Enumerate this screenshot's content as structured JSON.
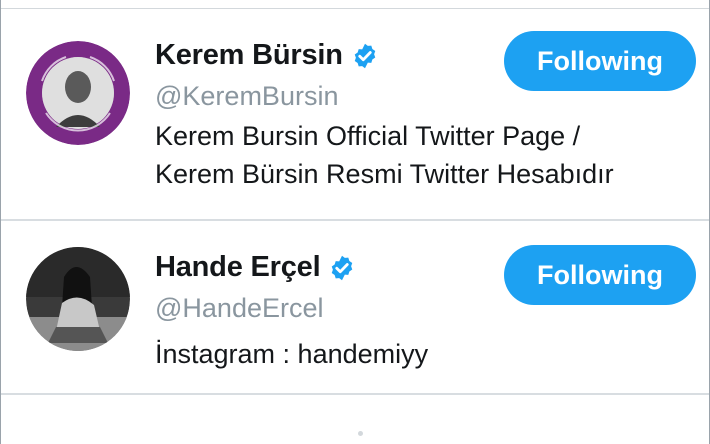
{
  "accent_color": "#1da1f2",
  "users": [
    {
      "name": "Kerem Bürsin",
      "handle": "@KeremBursin",
      "bio_lines": [
        "Kerem Bursin Official Twitter Page /",
        "Kerem Bürsin Resmi Twitter Hesabıdır"
      ],
      "verified": true,
      "follow_label": "Following",
      "avatar_icon": "profile-photo-with-purple-ring",
      "avatar_ring_text": "İSTANBUL SÖZLEŞMESİ YAŞATIR · 6284 UYGULA"
    },
    {
      "name": "Hande Erçel",
      "handle": "@HandeErcel",
      "bio_lines": [
        "İnstagram : handemiyy"
      ],
      "verified": true,
      "follow_label": "Following",
      "avatar_icon": "profile-photo-bw"
    }
  ]
}
